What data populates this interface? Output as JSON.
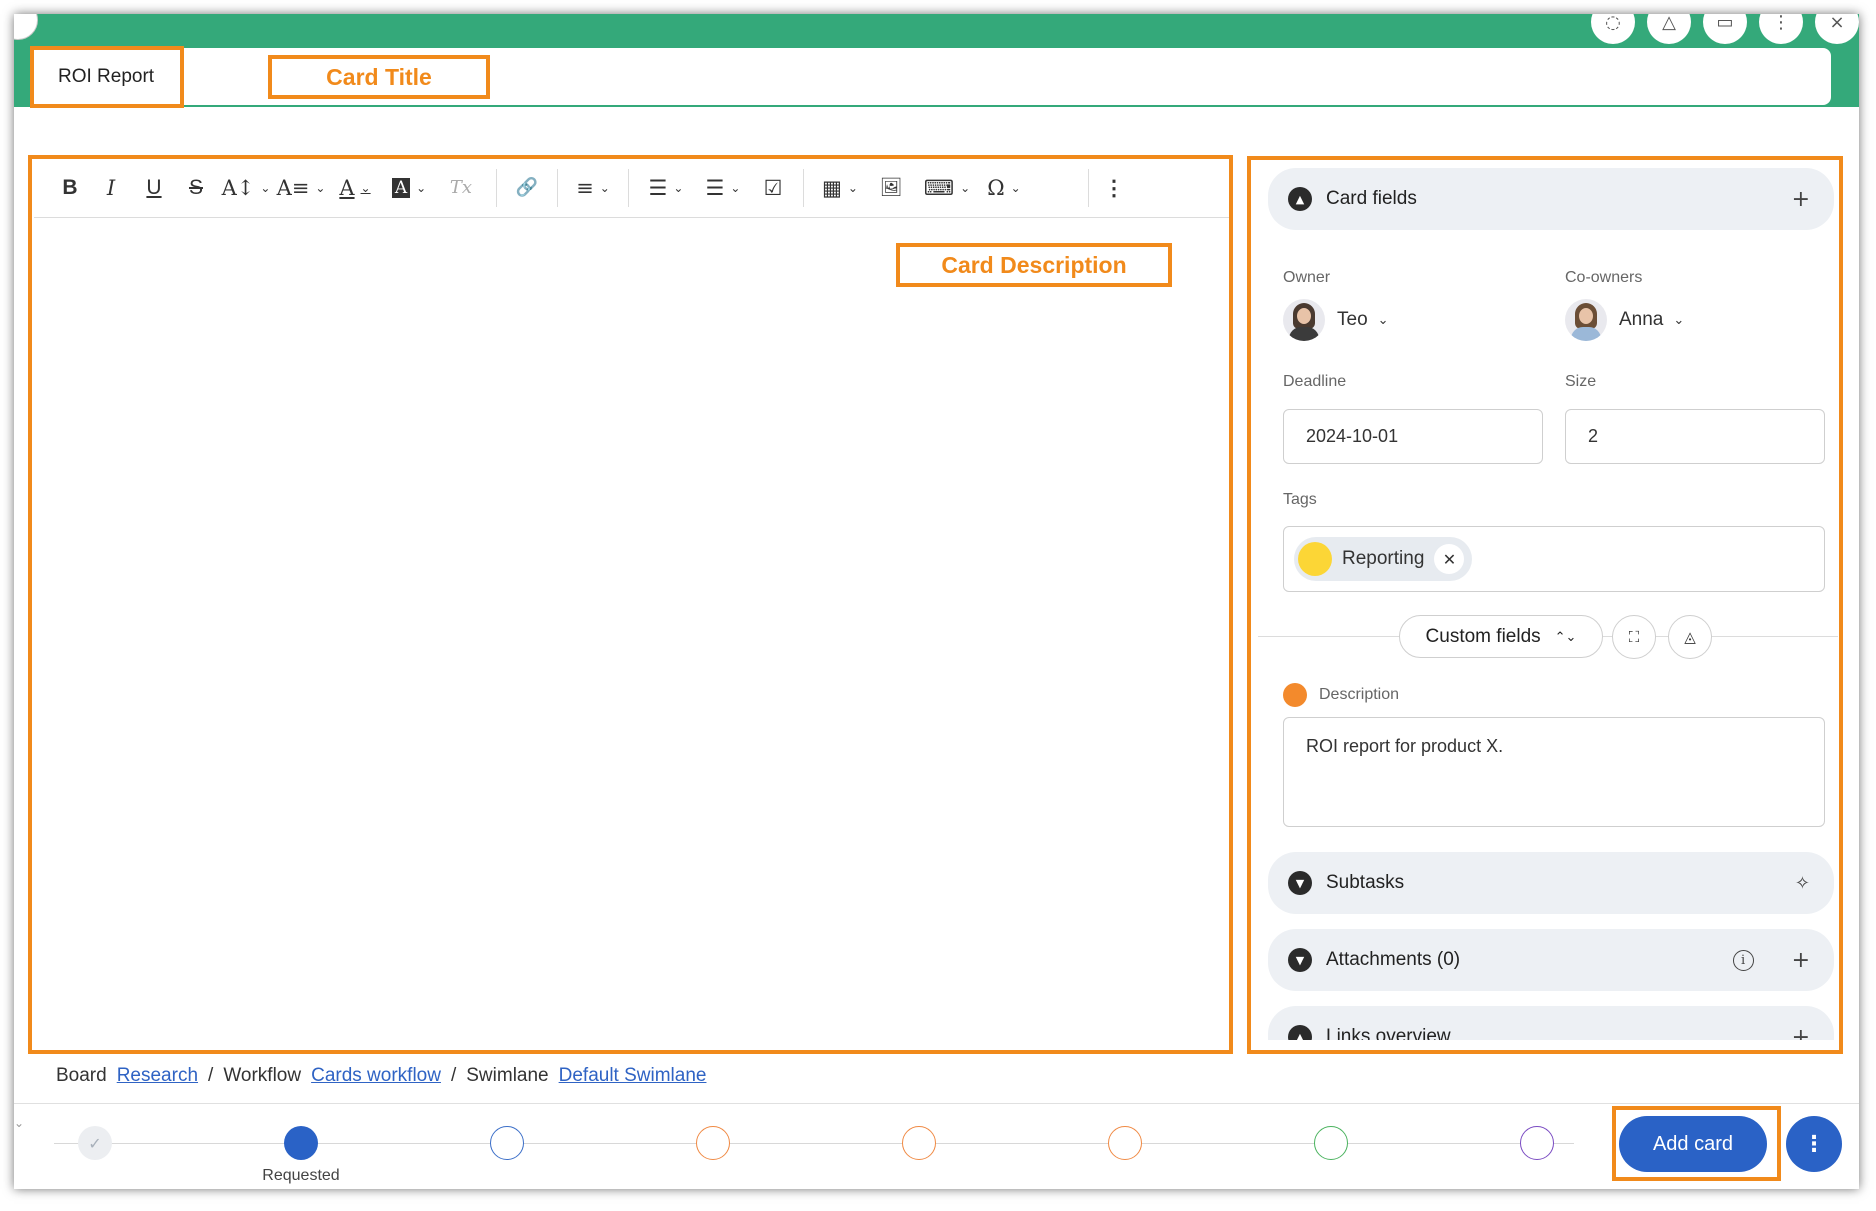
{
  "card": {
    "title": "ROI Report"
  },
  "annotations": {
    "card_title": "Card Title",
    "card_description": "Card Description"
  },
  "toolbar": {
    "bold": "B",
    "italic": "I",
    "underline": "U",
    "strike": "S",
    "font_size": "A↕",
    "font_style": "A≡",
    "font_color": "A",
    "highlight": "A",
    "clear_format": "Tx",
    "link": "🔗",
    "align": "≡",
    "bulleted": "☰",
    "numbered": "☰",
    "checklist": "☑",
    "table": "▦",
    "image": "🖼",
    "code": "⌨",
    "special": "Ω",
    "more": "⋮",
    "icons": [
      "bold-icon",
      "italic-icon",
      "underline-icon",
      "strikethrough-icon",
      "font-size-icon",
      "paragraph-style-icon",
      "text-color-icon",
      "highlight-icon",
      "clear-format-icon",
      "link-icon",
      "align-icon",
      "bulleted-list-icon",
      "numbered-list-icon",
      "checklist-icon",
      "table-icon",
      "image-icon",
      "code-snippet-icon",
      "special-character-icon",
      "more-vertical-icon"
    ]
  },
  "panel": {
    "card_fields": {
      "title": "Card fields",
      "add": "+"
    },
    "owner": {
      "label": "Owner",
      "name": "Teo"
    },
    "coowners": {
      "label": "Co-owners",
      "name": "Anna"
    },
    "deadline": {
      "label": "Deadline",
      "value": "2024-10-01"
    },
    "size": {
      "label": "Size",
      "value": "2"
    },
    "tags": {
      "label": "Tags",
      "items": [
        {
          "name": "Reporting",
          "color": "#fcd636"
        }
      ]
    },
    "custom_fields": {
      "label": "Custom fields"
    },
    "description": {
      "label": "Description",
      "value": "ROI report for product X.",
      "color": "#f38a2c"
    },
    "subtasks": {
      "title": "Subtasks"
    },
    "attachments": {
      "title": "Attachments (0)"
    },
    "links_overview": {
      "title": "Links overview"
    }
  },
  "breadcrumb": {
    "board_label": "Board",
    "board_link": "Research",
    "workflow_label": "Workflow",
    "workflow_link": "Cards workflow",
    "swimlane_label": "Swimlane",
    "swimlane_link": "Default Swimlane",
    "sep": "/"
  },
  "workflow": {
    "current_label": "Requested",
    "stage_colors": [
      "#eceef1",
      "#2a62c6",
      "#3c6fc8",
      "#f08a44",
      "#f08a44",
      "#f08a44",
      "#4bb35f",
      "#7a4bc2"
    ]
  },
  "actions": {
    "add_card": "Add card",
    "more": "⋮"
  },
  "colors": {
    "header_green": "#34a97a",
    "accent_blue": "#2a62c6",
    "annotation_orange": "#f18a1b"
  }
}
